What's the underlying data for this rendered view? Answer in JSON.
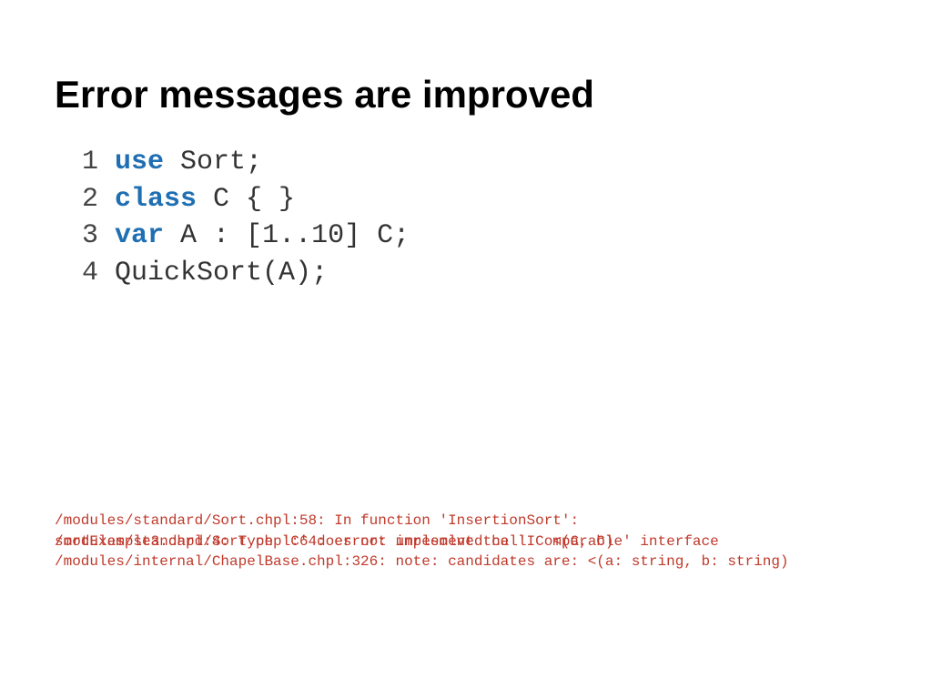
{
  "title": "Error messages are improved",
  "code": {
    "lines": [
      {
        "num": "1",
        "kw": "use",
        "rest": " Sort;"
      },
      {
        "num": "2",
        "kw": "class",
        "rest": " C { }"
      },
      {
        "num": "3",
        "kw": "var",
        "rest": " A : [1..10] C;"
      },
      {
        "num": "4",
        "kw": "",
        "rest": "QuickSort(A);"
      }
    ]
  },
  "errors": {
    "line1": "/modules/standard/Sort.chpl:58: In function 'InsertionSort':",
    "line2_layer1": "/modules/standard/Sort.chpl:64: error: unresolved call   <(C, C)",
    "line2_layer2": "sortExample3.chpl:4: Type 'C' does not implement the 'IComparable' interface",
    "line3": "/modules/internal/ChapelBase.chpl:326: note: candidates are: <(a: string, b: string)"
  }
}
